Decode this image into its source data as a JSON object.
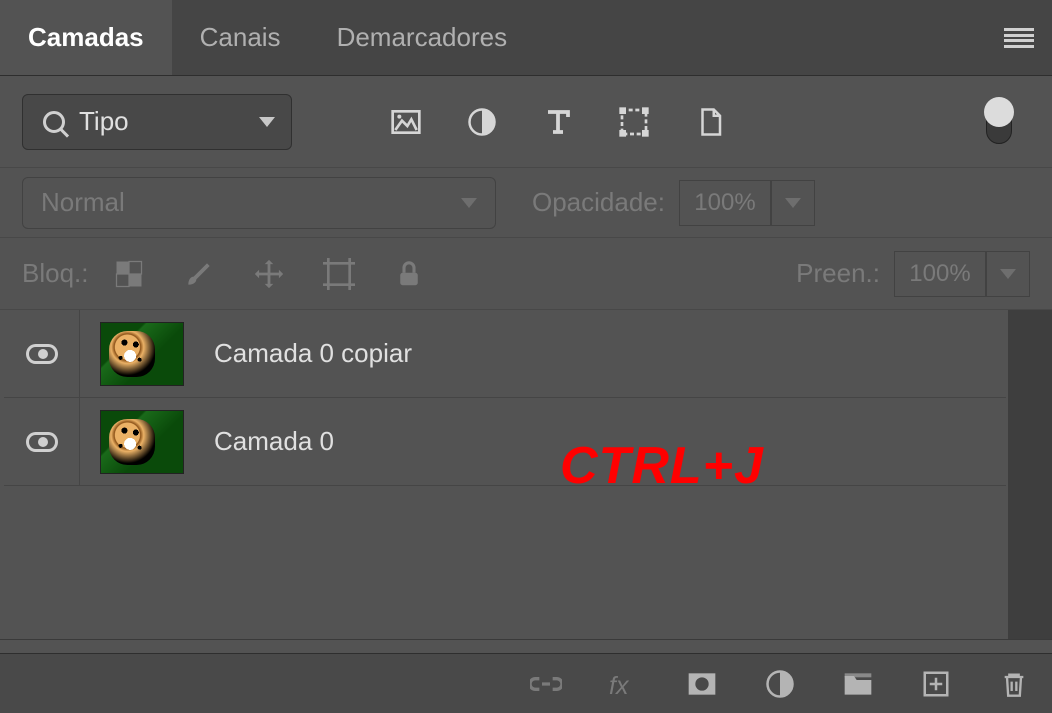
{
  "tabs": {
    "layers": "Camadas",
    "channels": "Canais",
    "paths": "Demarcadores"
  },
  "filter": {
    "label": "Tipo"
  },
  "blend": {
    "mode": "Normal",
    "opacity_label": "Opacidade:",
    "opacity_value": "100%"
  },
  "lock": {
    "label": "Bloq.:",
    "fill_label": "Preen.:",
    "fill_value": "100%"
  },
  "layers": [
    {
      "name": "Camada 0 copiar",
      "visible": true
    },
    {
      "name": "Camada 0",
      "visible": true
    }
  ],
  "annotation": "CTRL+J"
}
